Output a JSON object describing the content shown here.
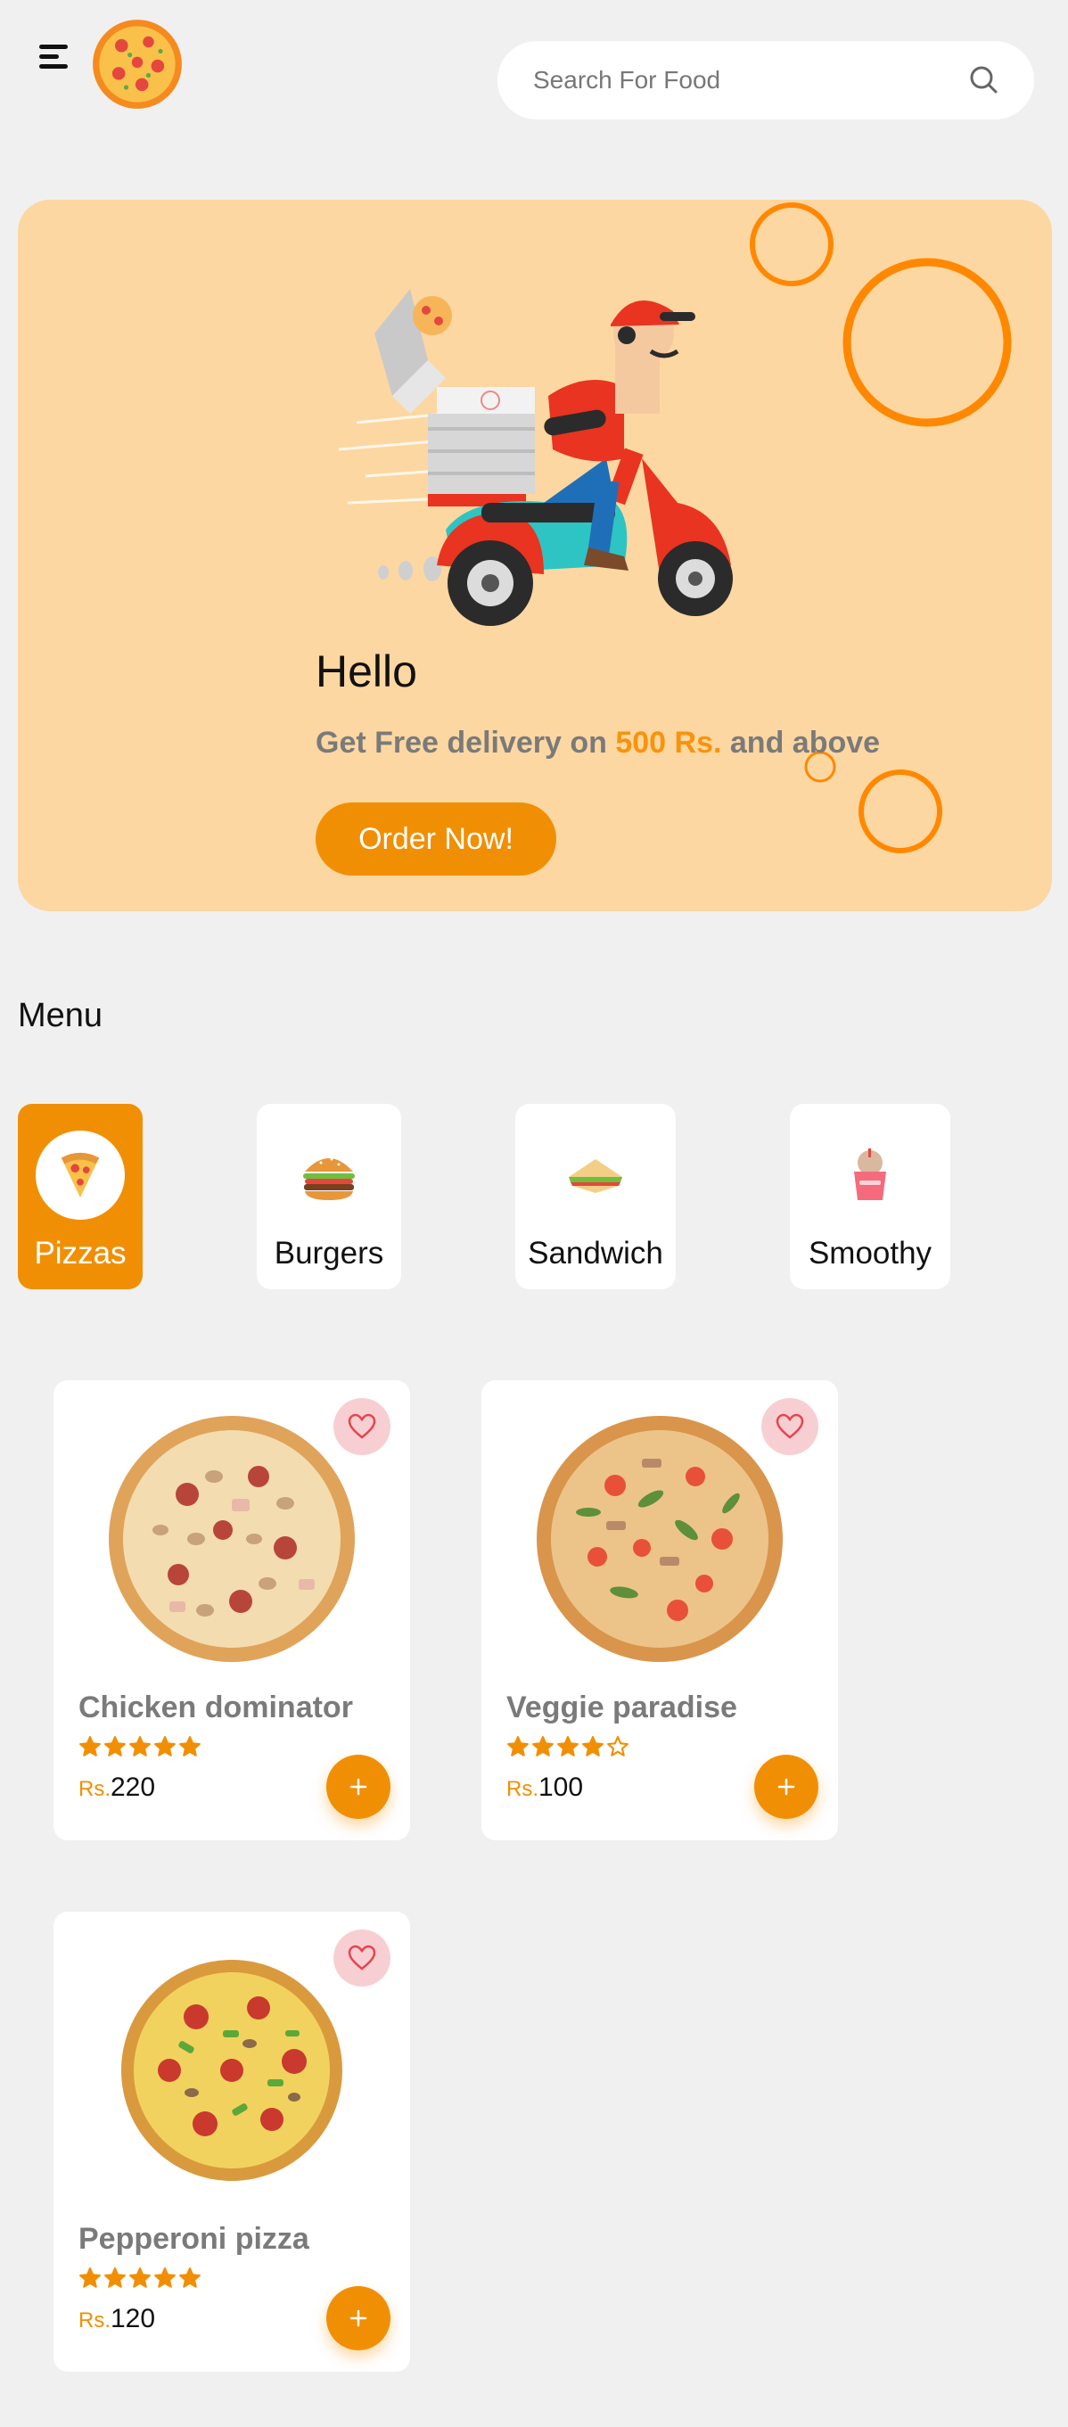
{
  "header": {
    "menu_icon": "hamburger-menu-icon",
    "logo_icon": "pizza-logo-icon",
    "search": {
      "placeholder": "Search For Food",
      "value": "",
      "icon": "search-icon"
    }
  },
  "hero": {
    "title": "Hello",
    "subtitle_prefix": "Get Free delivery on ",
    "subtitle_highlight": "500 Rs.",
    "subtitle_suffix": " and above",
    "cta_label": "Order Now!",
    "illustration": "delivery-scooter-illustration"
  },
  "menu": {
    "title": "Menu",
    "categories": [
      {
        "label": "Pizzas",
        "icon": "pizza-slice-icon",
        "active": true
      },
      {
        "label": "Burgers",
        "icon": "burger-icon",
        "active": false
      },
      {
        "label": "Sandwich",
        "icon": "sandwich-icon",
        "active": false
      },
      {
        "label": "Smoothy",
        "icon": "smoothie-icon",
        "active": false
      }
    ]
  },
  "products": [
    {
      "name": "Chicken dominator",
      "rating": 5,
      "currency": "Rs.",
      "price": "220"
    },
    {
      "name": "Veggie paradise",
      "rating": 4,
      "currency": "Rs.",
      "price": "100"
    },
    {
      "name": "Pepperoni pizza",
      "rating": 5,
      "currency": "Rs.",
      "price": "120"
    }
  ],
  "colors": {
    "accent": "#f18f04",
    "hero_bg": "#fdd7a1",
    "page_bg": "#f0f0f0",
    "favorite_bg": "#f7cfd3",
    "heart": "#e8434f"
  }
}
